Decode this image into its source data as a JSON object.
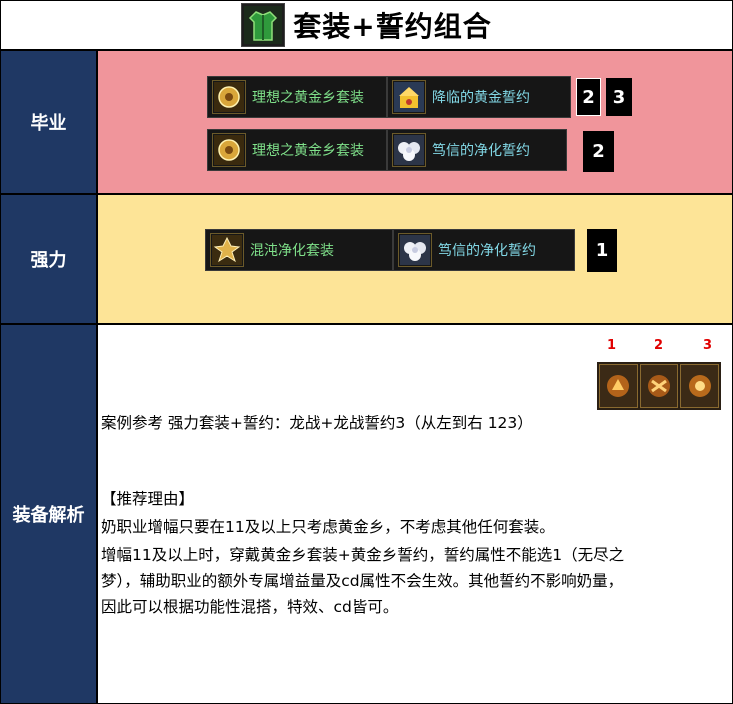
{
  "header": {
    "title": "套装+誓约组合",
    "icon": "green-armor-icon"
  },
  "rows": {
    "graduation": {
      "label": "毕业",
      "combos": [
        {
          "set_name": "理想之黄金乡套装",
          "set_icon": "golden-sphere-icon",
          "pledge_name": "降临的黄金誓约",
          "pledge_icon": "gold-treasure-icon",
          "nums": [
            "2",
            "3"
          ]
        },
        {
          "set_name": "理想之黄金乡套装",
          "set_icon": "golden-sphere-icon",
          "pledge_name": "笃信的净化誓约",
          "pledge_icon": "white-flower-icon",
          "nums": [
            "2"
          ]
        }
      ]
    },
    "strong": {
      "label": "强力",
      "combo": {
        "set_name": "混沌净化套装",
        "set_icon": "chaos-gem-icon",
        "pledge_name": "笃信的净化誓约",
        "pledge_icon": "white-flower-icon",
        "num": "1"
      }
    },
    "analysis": {
      "label": "装备解析",
      "case_ref": "案例参考 强力套装+誓约：龙战+龙战誓约3（从左到右 123）",
      "case_nums": [
        "1",
        "2",
        "3"
      ],
      "reason_title": "【推荐理由】",
      "reason_lines": [
        "奶职业增幅只要在11及以上只考虑黄金乡，不考虑其他任何套装。",
        "增幅11及以上时，穿戴黄金乡套装+黄金乡誓约，誓约属性不能选1（无尽之",
        "梦），辅助职业的额外专属增益量及cd属性不会生效。其他誓约不影响奶量，",
        "因此可以根据功能性混搭，特效、cd皆可。"
      ]
    }
  },
  "colors": {
    "label_bg": "#1f3864",
    "graduation_bg": "#f0959b",
    "strong_bg": "#fde497",
    "set_text": "#7fe08a",
    "pledge_text": "#82d8e6",
    "case_num": "#e00000"
  }
}
